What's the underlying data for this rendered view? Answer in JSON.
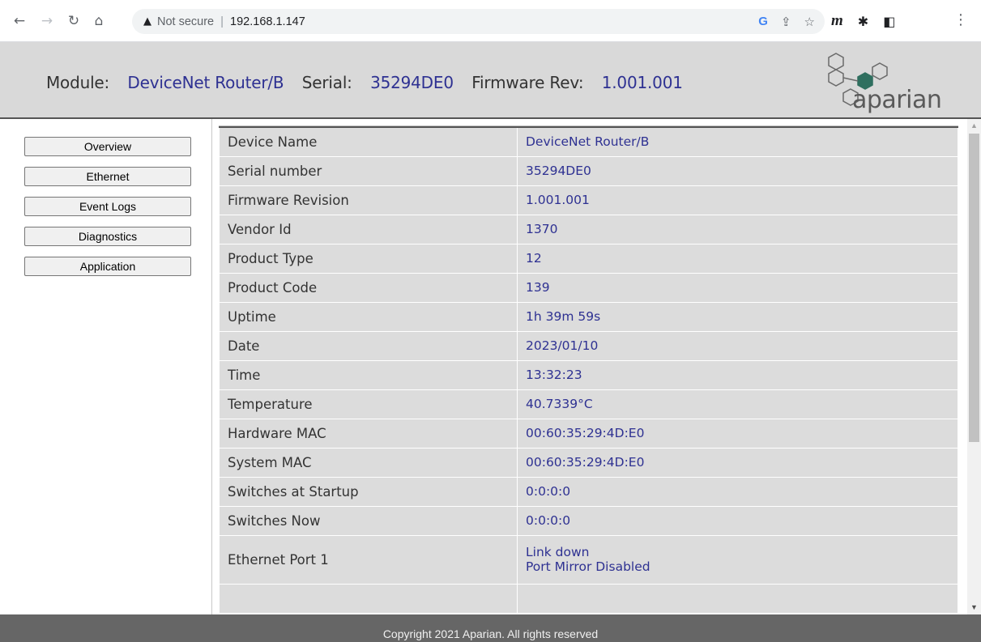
{
  "browser": {
    "not_secure": "Not secure",
    "separator": "|",
    "url": "192.168.1.147"
  },
  "header": {
    "module_label": "Module:",
    "module_value": "DeviceNet Router/B",
    "serial_label": "Serial:",
    "serial_value": "35294DE0",
    "firmware_label": "Firmware Rev:",
    "firmware_value": "1.001.001",
    "logo_text": "aparian"
  },
  "sidebar": {
    "items": [
      {
        "label": "Overview"
      },
      {
        "label": "Ethernet"
      },
      {
        "label": "Event Logs"
      },
      {
        "label": "Diagnostics"
      },
      {
        "label": "Application"
      }
    ]
  },
  "table": {
    "rows": [
      {
        "label": "Device Name",
        "value": "DeviceNet Router/B"
      },
      {
        "label": "Serial number",
        "value": "35294DE0"
      },
      {
        "label": "Firmware Revision",
        "value": "1.001.001"
      },
      {
        "label": "Vendor Id",
        "value": "1370"
      },
      {
        "label": "Product Type",
        "value": "12"
      },
      {
        "label": "Product Code",
        "value": "139"
      },
      {
        "label": "Uptime",
        "value": "1h 39m 59s"
      },
      {
        "label": "Date",
        "value": "2023/01/10"
      },
      {
        "label": "Time",
        "value": "13:32:23"
      },
      {
        "label": "Temperature",
        "value": "40.7339°C"
      },
      {
        "label": "Hardware MAC",
        "value": "00:60:35:29:4D:E0"
      },
      {
        "label": "System MAC",
        "value": "00:60:35:29:4D:E0"
      },
      {
        "label": "Switches at Startup",
        "value": "0:0:0:0"
      },
      {
        "label": "Switches Now",
        "value": "0:0:0:0"
      }
    ],
    "ethernet_port": {
      "label": "Ethernet Port 1",
      "line1": "Link down",
      "line2": "Port Mirror Disabled"
    }
  },
  "footer": {
    "text": "Copyright 2021 Aparian. All rights reserved"
  }
}
